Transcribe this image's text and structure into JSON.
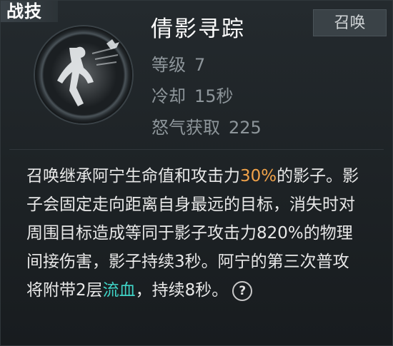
{
  "tab": {
    "label": "战技"
  },
  "skill": {
    "name": "倩影寻踪",
    "type_badge": "召唤",
    "icon": "shadow-dash-icon"
  },
  "stats": {
    "level": {
      "label": "等级",
      "value": "7"
    },
    "cooldown": {
      "label": "冷却",
      "value": "15秒"
    },
    "rage": {
      "label": "怒气获取",
      "value": "225"
    }
  },
  "description": {
    "seg1": "召唤继承阿宁生命值和攻击力",
    "seg2_highlight": "30%",
    "seg3": "的影子。影子会固定走向距离自身最远的目标，消失时对周围目标造成等同于影子攻击力820%的物理间接伤害，影子持续3秒。阿宁的第三次普攻将附带2层",
    "seg4_highlight": "流血",
    "seg5": "，持续8秒。",
    "help_glyph": "?"
  },
  "colors": {
    "highlight_orange": "#f0a24a",
    "highlight_cyan": "#3fd3c6",
    "stat_gray": "#8d959a"
  }
}
